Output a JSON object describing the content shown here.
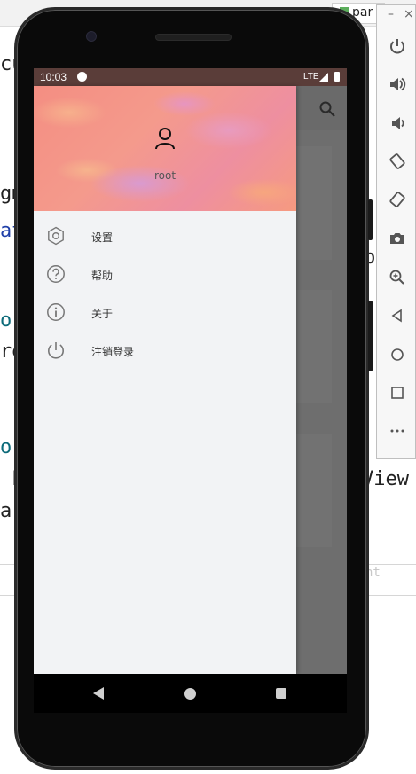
{
  "ide": {
    "tab_label": "par",
    "code_fragments": {
      "line1": "cu",
      "line2": "gm",
      "line3": "at",
      "line3_right": "p",
      "line4": "or",
      "line5": "re",
      "line6": "or",
      "line7": " L",
      "line7_right": "View",
      "line8": "ar"
    },
    "gutter_text": "nt"
  },
  "emulator_panel": {
    "minimize": "–",
    "close": "×",
    "buttons": [
      "power-icon",
      "volume-up-icon",
      "volume-down-icon",
      "rotate-left-icon",
      "rotate-right-icon",
      "camera-icon",
      "zoom-icon",
      "back-icon",
      "home-icon",
      "overview-icon",
      "more-icon"
    ]
  },
  "status_bar": {
    "time": "10:03",
    "network": "LTE"
  },
  "drawer": {
    "username": "root",
    "menu_items": [
      {
        "label": "设置",
        "icon": "settings-icon"
      },
      {
        "label": "帮助",
        "icon": "help-icon"
      },
      {
        "label": "关于",
        "icon": "info-icon"
      },
      {
        "label": "注销登录",
        "icon": "power-icon"
      }
    ]
  },
  "colors": {
    "drawer_background": "#f2f3f5",
    "header_accent": "#f48e82",
    "scrim": "#6e6e6e"
  }
}
